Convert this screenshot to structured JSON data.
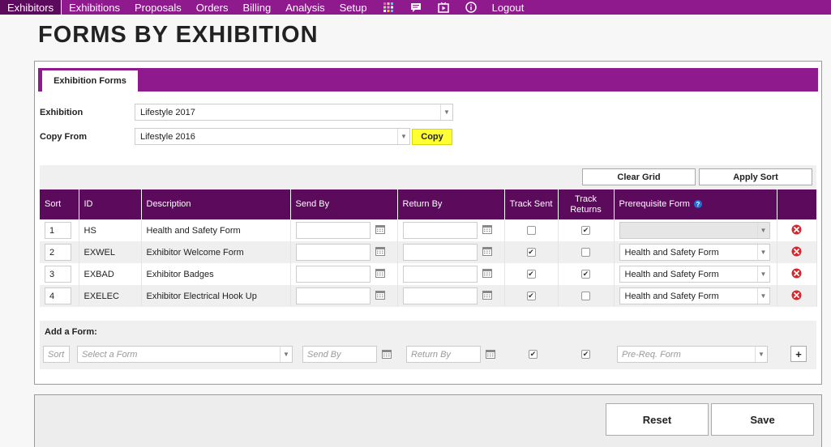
{
  "nav": {
    "items": [
      {
        "label": "Exhibitors",
        "active": true
      },
      {
        "label": "Exhibitions"
      },
      {
        "label": "Proposals"
      },
      {
        "label": "Orders"
      },
      {
        "label": "Billing"
      },
      {
        "label": "Analysis"
      },
      {
        "label": "Setup"
      }
    ],
    "icons": [
      "grid-icon",
      "chat-icon",
      "media-icon",
      "info-icon"
    ],
    "logout": "Logout"
  },
  "page_title": "FORMS BY EXHIBITION",
  "tab": {
    "label": "Exhibition Forms"
  },
  "exhibition": {
    "label": "Exhibition",
    "value": "Lifestyle 2017"
  },
  "copy_from": {
    "label": "Copy From",
    "value": "Lifestyle 2016",
    "button": "Copy"
  },
  "toolbar": {
    "clear_grid": "Clear Grid",
    "apply_sort": "Apply Sort"
  },
  "grid": {
    "columns": [
      "Sort",
      "ID",
      "Description",
      "Send By",
      "Return By",
      "Track Sent",
      "Track\nReturns",
      "Prerequisite Form"
    ],
    "rows": [
      {
        "sort": "1",
        "id": "HS",
        "description": "Health and Safety Form",
        "send_by": "",
        "return_by": "",
        "track_sent": false,
        "track_returns": true,
        "prereq": ""
      },
      {
        "sort": "2",
        "id": "EXWEL",
        "description": "Exhibitor Welcome Form",
        "send_by": "",
        "return_by": "",
        "track_sent": true,
        "track_returns": false,
        "prereq": "Health and Safety Form"
      },
      {
        "sort": "3",
        "id": "EXBAD",
        "description": "Exhibitor Badges",
        "send_by": "",
        "return_by": "",
        "track_sent": true,
        "track_returns": true,
        "prereq": "Health and Safety Form"
      },
      {
        "sort": "4",
        "id": "EXELEC",
        "description": "Exhibitor Electrical Hook Up",
        "send_by": "",
        "return_by": "",
        "track_sent": true,
        "track_returns": false,
        "prereq": "Health and Safety Form"
      }
    ]
  },
  "add_form": {
    "title": "Add a Form:",
    "sort_placeholder": "Sort",
    "form_placeholder": "Select a Form",
    "send_by_placeholder": "Send By",
    "return_by_placeholder": "Return By",
    "prereq_placeholder": "Pre-Req. Form",
    "add_button": "+"
  },
  "actions": {
    "reset": "Reset",
    "save": "Save"
  },
  "colors": {
    "brand_purple": "#8e1a8e",
    "header_purple": "#5c0a5c",
    "highlight": "#ffff33",
    "delete_red": "#d9262c"
  }
}
